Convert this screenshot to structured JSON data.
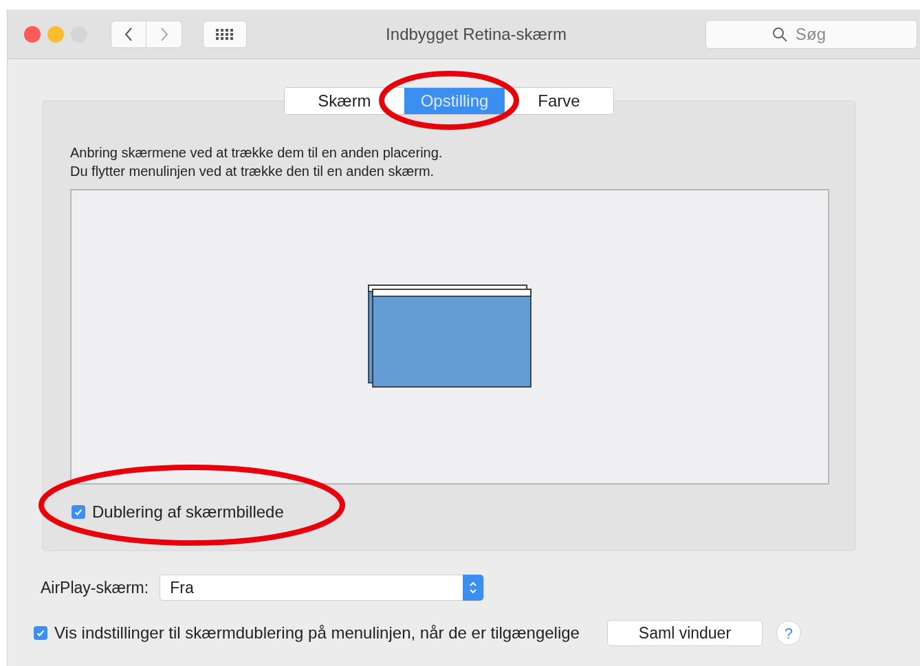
{
  "window": {
    "title": "Indbygget Retina-skærm"
  },
  "search": {
    "placeholder": "Søg"
  },
  "tabs": [
    {
      "label": "Skærm",
      "selected": false
    },
    {
      "label": "Opstilling",
      "selected": true
    },
    {
      "label": "Farve",
      "selected": false
    }
  ],
  "instructions": [
    "Anbring skærmene ved at trække dem til en anden placering.",
    "Du flytter menulinjen ved at trække den til en anden skærm."
  ],
  "mirroring": {
    "label": "Dublering af skærmbillede",
    "checked": true
  },
  "airplay": {
    "label": "AirPlay-skærm:",
    "value": "Fra"
  },
  "menu_option": {
    "label": "Vis indstillinger til skærmdublering på menulinjen, når de er tilgængelige",
    "checked": true
  },
  "gather_button": "Saml vinduer",
  "help_button": "?"
}
